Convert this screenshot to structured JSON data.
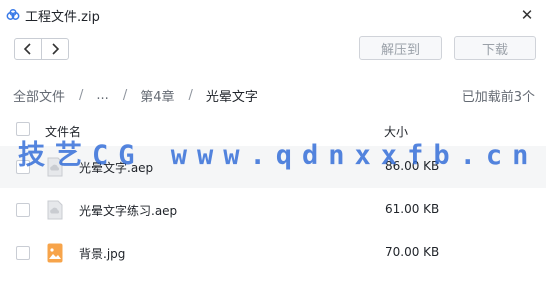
{
  "window": {
    "title": "工程文件.zip",
    "app_icon": "cloud-drive-icon",
    "close_glyph": "✕"
  },
  "toolbar": {
    "back_icon": "chevron-left-icon",
    "forward_icon": "chevron-right-icon",
    "extract_label": "解压到",
    "download_label": "下载"
  },
  "breadcrumb": {
    "items": [
      "全部文件",
      "...",
      "第4章",
      "光晕文字"
    ],
    "separator": "/"
  },
  "status": {
    "loaded_text": "已加载前3个"
  },
  "table": {
    "columns": {
      "name": "文件名",
      "size": "大小"
    },
    "rows": [
      {
        "name": "光晕文字.aep",
        "size": "86.00 KB",
        "icon": "document-icon"
      },
      {
        "name": "光晕文字练习.aep",
        "size": "61.00 KB",
        "icon": "document-icon"
      },
      {
        "name": "背景.jpg",
        "size": "70.00 KB",
        "icon": "image-file-icon"
      }
    ]
  },
  "watermark": {
    "text": "技艺CG www.qdnxxfb.cn",
    "color": "#2f6bd8"
  },
  "colors": {
    "accent": "#2f6bd8",
    "image_icon": "#f7a44a",
    "doc_icon": "#c9ccd1"
  }
}
